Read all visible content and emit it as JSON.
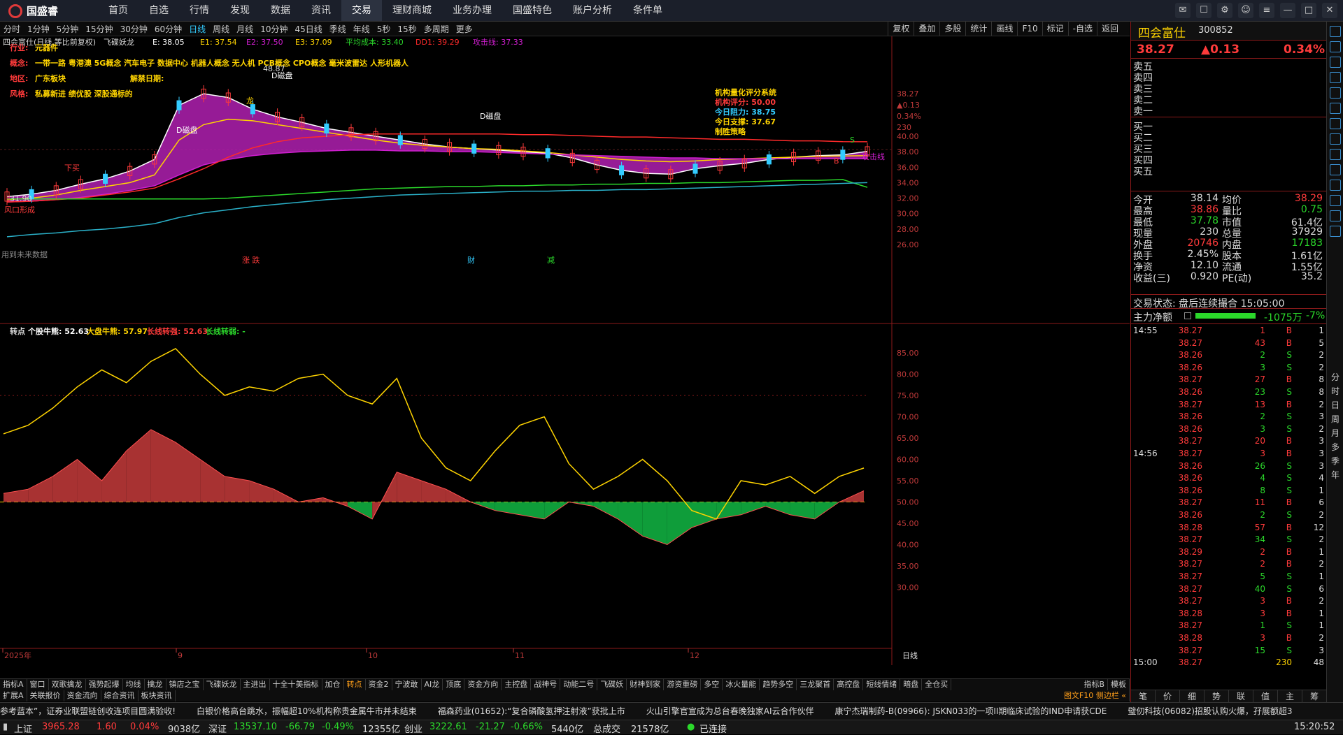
{
  "app": {
    "name": "国盛睿"
  },
  "menu": [
    "首页",
    "自选",
    "行情",
    "发现",
    "数据",
    "资讯",
    "交易",
    "理财商城",
    "业务办理",
    "国盛特色",
    "账户分析",
    "条件单"
  ],
  "menu_active": "交易",
  "periods": [
    "分时",
    "1分钟",
    "5分钟",
    "15分钟",
    "30分钟",
    "60分钟",
    "日线",
    "周线",
    "月线",
    "10分钟",
    "45日线",
    "季线",
    "年线",
    "5秒",
    "15秒",
    "多周期",
    "更多"
  ],
  "period_active": "日线",
  "toolbar_right": [
    "复权",
    "叠加",
    "多股",
    "统计",
    "画线",
    "F10",
    "标记",
    "-自选",
    "返回"
  ],
  "kline_header": {
    "title": "四会富仕(日线,等比前复权)",
    "indicator": "飞碟妖龙",
    "e": "E: 38.05",
    "e1": "E1: 37.54",
    "e2": "E2: 37.50",
    "e3": "E3: 37.09",
    "avgcost": "平均成本: 33.40",
    "dd1": "DD1: 39.29",
    "attack": "攻击线: 37.33"
  },
  "info_lines": {
    "industry_label": "行业:",
    "industry": "元器件",
    "concept_label": "概念:",
    "concept": "一带一路 粤港澳 5G概念 汽车电子 数据中心 机器人概念 无人机 PCB概念 CPO概念 毫米波雷达 人形机器人",
    "region_label": "地区:",
    "region": "广东板块",
    "unlock_label": "解禁日期:",
    "style_label": "风格:",
    "style": "私募新进 绩优股 深股通标的"
  },
  "score_box": {
    "title": "机构量化评分系统",
    "score": "机构评分: 50.00",
    "resistance": "今日阻力: 38.75",
    "support": "今日支撑: 37.67",
    "strategy": "制胜策略"
  },
  "chart_labels": {
    "high": "48.87",
    "low": "31.90",
    "dcp1": "D磁盘",
    "dcp2": "D磁盘",
    "dcp3": "D磁盘",
    "dragon": "龙",
    "buy": "下买",
    "pattern": "风口形成",
    "attack_line": "攻击线",
    "unused": "用到未来数据",
    "m1": "涨 跌",
    "m2": "财",
    "m3": "减",
    "s": "S",
    "b": "B"
  },
  "kline_axis": [
    "40.00",
    "38.00",
    "36.00",
    "34.00",
    "32.00",
    "30.00",
    "28.00",
    "26.00"
  ],
  "kline_right_info": [
    "38.27",
    "▲0.13",
    "0.34%",
    "230"
  ],
  "indicator_header": {
    "name": "转点",
    "stock": "个股牛熊: 52.63",
    "market": "大盘牛熊: 57.97",
    "long_strong": "长线转强: 52.63",
    "long_weak": "长线转弱: -"
  },
  "indicator_axis": [
    "85.00",
    "80.00",
    "75.00",
    "70.00",
    "65.00",
    "60.00",
    "55.00",
    "50.00",
    "45.00",
    "40.00",
    "35.00",
    "30.00"
  ],
  "x_axis": [
    "2025年",
    "9",
    "10",
    "11",
    "12"
  ],
  "x_axis_end": "日线",
  "chart_data": [
    {
      "type": "line",
      "title": "四会富仕(日线,等比前复权)",
      "ylim": [
        25,
        50
      ],
      "series": [
        {
          "name": "MA",
          "values": [
            32.2,
            32.5,
            33.0,
            33.8,
            34.5,
            35.5,
            37.0,
            44.0,
            45.5,
            45.0,
            43.5,
            42.5,
            41.8,
            41.0,
            40.5,
            40.0,
            39.5,
            39.0,
            38.6,
            38.4,
            38.2,
            38.0,
            37.8,
            37.2,
            36.3,
            35.6,
            35.2,
            35.1,
            35.8,
            36.2,
            36.5,
            37.0,
            37.3,
            37.5,
            37.6,
            38.05
          ]
        },
        {
          "name": "E2",
          "values": [
            31.8,
            32.0,
            32.4,
            33.0,
            33.5,
            34.0,
            35.0,
            39.5,
            41.5,
            42.2,
            42.0,
            41.5,
            41.0,
            40.5,
            40.0,
            39.5,
            39.1,
            38.8,
            38.6,
            38.4,
            38.3,
            38.1,
            37.9,
            37.6,
            37.3,
            37.0,
            36.8,
            36.7,
            36.8,
            37.0,
            37.1,
            37.2,
            37.3,
            37.4,
            37.45,
            37.5
          ]
        },
        {
          "name": "E3",
          "values": [
            31.5,
            31.6,
            31.8,
            32.1,
            32.5,
            33.0,
            33.6,
            35.0,
            36.3,
            37.0,
            37.5,
            37.8,
            38.0,
            38.1,
            38.2,
            38.2,
            38.1,
            38.1,
            38.0,
            38.0,
            37.9,
            37.8,
            37.7,
            37.6,
            37.5,
            37.4,
            37.3,
            37.2,
            37.2,
            37.1,
            37.1,
            37.1,
            37.1,
            37.1,
            37.1,
            37.09
          ]
        },
        {
          "name": "DD1",
          "values": [
            31.5,
            31.6,
            31.8,
            32.0,
            32.4,
            32.8,
            33.3,
            34.5,
            35.8,
            37.3,
            38.5,
            39.3,
            39.8,
            40.0,
            40.2,
            40.3,
            40.3,
            40.3,
            40.3,
            40.3,
            40.3,
            40.2,
            40.2,
            40.1,
            40.0,
            39.9,
            39.9,
            39.8,
            39.7,
            39.6,
            39.6,
            39.5,
            39.4,
            39.4,
            39.3,
            39.29
          ]
        },
        {
          "name": "平均成本",
          "values": [
            31.9,
            31.9,
            31.9,
            31.9,
            31.9,
            31.9,
            31.9,
            31.9,
            31.9,
            32.0,
            32.2,
            32.4,
            32.6,
            32.8,
            33.0,
            33.2,
            33.3,
            33.4,
            33.5,
            33.5,
            33.6,
            33.6,
            33.7,
            33.7,
            33.8,
            33.8,
            33.9,
            33.9,
            34.0,
            34.0,
            34.1,
            34.2,
            34.3,
            34.3,
            34.4,
            33.4
          ]
        },
        {
          "name": "LongMA",
          "values": [
            27.0,
            27.3,
            27.5,
            27.8,
            28.0,
            28.3,
            28.7,
            29.5,
            30.1,
            30.5,
            30.9,
            31.2,
            31.5,
            31.8,
            32.0,
            32.2,
            32.4,
            32.5,
            32.6,
            32.7,
            32.8,
            32.9,
            32.9,
            33.0,
            33.0,
            33.1,
            33.1,
            33.2,
            33.3,
            33.4,
            33.5,
            33.6,
            33.7,
            33.8,
            33.9,
            34.0
          ]
        }
      ]
    },
    {
      "type": "area",
      "title": "转点",
      "ylim": [
        25,
        88
      ],
      "series": [
        {
          "name": "个股牛熊",
          "values": [
            52,
            53,
            56,
            60,
            55,
            62,
            67,
            64,
            60,
            56,
            55,
            53,
            50,
            51,
            49,
            46,
            57,
            55,
            53,
            50,
            48,
            47,
            46,
            50,
            49,
            46,
            42,
            40,
            44,
            46,
            47,
            49,
            47,
            46,
            50,
            52.63
          ]
        },
        {
          "name": "大盘牛熊",
          "values": [
            66,
            68,
            72,
            77,
            81,
            78,
            83,
            86,
            80,
            75,
            77,
            76,
            79,
            80,
            75,
            73,
            79,
            65,
            58,
            55,
            62,
            68,
            70,
            59,
            53,
            56,
            60,
            55,
            48,
            46,
            55,
            54,
            56,
            52,
            56,
            57.97
          ]
        }
      ]
    }
  ],
  "quote": {
    "name": "四会富仕",
    "code": "300852",
    "price": "38.27",
    "change": "▲0.13",
    "pct": "0.34%",
    "ask": [
      "卖五",
      "卖四",
      "卖三",
      "卖二",
      "卖一"
    ],
    "bid": [
      "买一",
      "买二",
      "买三",
      "买四",
      "买五"
    ],
    "stats": [
      [
        "今开",
        "38.14",
        "均价",
        "38.29"
      ],
      [
        "最高",
        "38.86",
        "量比",
        "0.75"
      ],
      [
        "最低",
        "37.78",
        "市值",
        "61.4亿"
      ],
      [
        "现量",
        "230",
        "总量",
        "37929"
      ],
      [
        "外盘",
        "20746",
        "内盘",
        "17183"
      ],
      [
        "换手",
        "2.45%",
        "股本",
        "1.61亿"
      ],
      [
        "净资",
        "12.10",
        "流通",
        "1.55亿"
      ],
      [
        "收益(三)",
        "0.920",
        "PE(动)",
        "35.2"
      ]
    ],
    "status": "交易状态: 盘后连续撮合 15:05:00",
    "netflow_label": "主力净额",
    "netflow": "-1075万",
    "netflow_pct": "-7%"
  },
  "ticks": {
    "time1": "14:55",
    "time2": "14:56",
    "time3": "15:00",
    "rows": [
      [
        "38.27",
        "1",
        "B",
        "1"
      ],
      [
        "38.27",
        "43",
        "B",
        "5"
      ],
      [
        "38.26",
        "2",
        "S",
        "2"
      ],
      [
        "38.26",
        "3",
        "S",
        "2"
      ],
      [
        "38.27",
        "27",
        "B",
        "8"
      ],
      [
        "38.26",
        "23",
        "S",
        "8"
      ],
      [
        "38.27",
        "13",
        "B",
        "2"
      ],
      [
        "38.26",
        "2",
        "S",
        "3"
      ],
      [
        "38.26",
        "3",
        "S",
        "2"
      ],
      [
        "38.27",
        "20",
        "B",
        "3"
      ],
      [
        "38.27",
        "3",
        "B",
        "3"
      ],
      [
        "38.26",
        "26",
        "S",
        "3"
      ],
      [
        "38.26",
        "4",
        "S",
        "4"
      ],
      [
        "38.26",
        "8",
        "S",
        "1"
      ],
      [
        "38.27",
        "11",
        "B",
        "6"
      ],
      [
        "38.26",
        "2",
        "S",
        "2"
      ],
      [
        "38.28",
        "57",
        "B",
        "12"
      ],
      [
        "38.27",
        "34",
        "S",
        "2"
      ],
      [
        "38.29",
        "2",
        "B",
        "1"
      ],
      [
        "38.27",
        "2",
        "B",
        "2"
      ],
      [
        "38.27",
        "5",
        "S",
        "1"
      ],
      [
        "38.27",
        "40",
        "S",
        "6"
      ],
      [
        "38.27",
        "3",
        "B",
        "2"
      ],
      [
        "38.28",
        "3",
        "B",
        "1"
      ],
      [
        "38.27",
        "1",
        "S",
        "1"
      ],
      [
        "38.28",
        "3",
        "B",
        "2"
      ],
      [
        "38.27",
        "15",
        "S",
        "3"
      ]
    ],
    "last": [
      "38.27",
      "230",
      "48"
    ]
  },
  "right_tabs": [
    "笔",
    "价",
    "细",
    "势",
    "联",
    "值",
    "主",
    "筹"
  ],
  "right_sidebar": [
    "分",
    "时",
    "日",
    "周",
    "月",
    "多",
    "季",
    "年"
  ],
  "bottom_tabs1": [
    "指标A",
    "窗口",
    "双歌擒龙",
    "强势起爆",
    "均线",
    "擒龙",
    "镇店之宝",
    "飞碟妖龙",
    "主进出",
    "十全十美指标",
    "加仓",
    "转点",
    "资金2",
    "宁波敢",
    "AI龙",
    "顶底",
    "资金方向",
    "主控盘",
    "战神号",
    "动能二号",
    "飞碟妖",
    "财神到家",
    "游资重磅",
    "多空",
    "冰火量能",
    "趋势多空",
    "三龙聚首",
    "高控盘",
    "短线情绪",
    "暗盘",
    "全仓买"
  ],
  "bottom_tabs1_active": "转点",
  "bottom_tabs1_right": [
    "指标B",
    "模板"
  ],
  "bottom_tabs2": [
    "扩展A",
    "关联报价",
    "资金流向",
    "综合资讯",
    "板块资讯"
  ],
  "bottom_tabs2_right": "图文F10 侧边栏 «",
  "news": [
    "参考蓝本”，证券业联盟链创收连项目圆满验收!",
    "白银价格高台跳水，振幅超10%机构称贵金属牛市并未结束",
    "福森药业(01652):“复合磷酸氢押注射液”获批上市",
    "火山引擎官宣成为总台春晚独家AI云合作伙伴",
    "康宁杰瑞制药-B(09966): JSKN033的一项II期临床试验的IND申请获CDE",
    "璧仞科技(06082)招股认购火爆，孖展额超3"
  ],
  "status_bar": {
    "sh_label": "上证",
    "sh": "3965.28",
    "sh_chg": "1.60",
    "sh_pct": "0.04%",
    "sh_amt": "9038亿",
    "sz_label": "深证",
    "sz": "13537.10",
    "sz_chg": "-66.79",
    "sz_pct": "-0.49%",
    "sz_amt": "12355亿",
    "cy_label": "创业",
    "cy": "3222.61",
    "cy_chg": "-21.27",
    "cy_pct": "-0.66%",
    "cy_amt": "5440亿",
    "total_label": "总成交",
    "total": "21578亿",
    "conn": "已连接",
    "time": "15:20:52"
  }
}
